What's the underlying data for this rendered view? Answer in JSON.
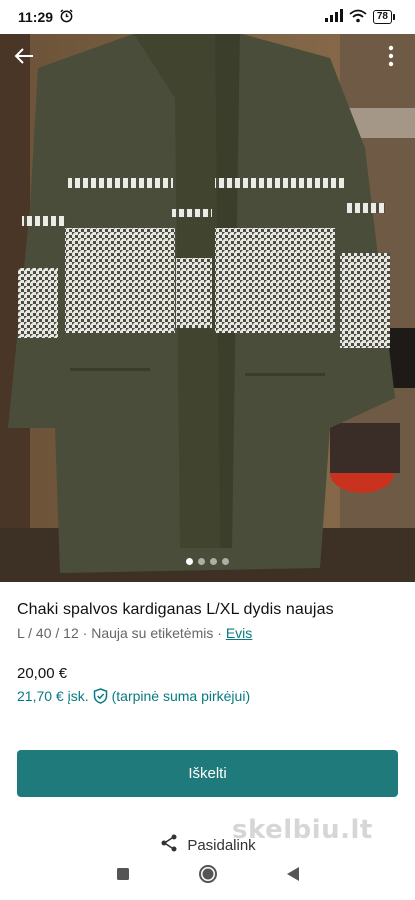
{
  "status_bar": {
    "time": "11:29",
    "battery": "78"
  },
  "listing": {
    "title": "Chaki spalvos kardiganas L/XL dydis naujas",
    "size": "L / 40 / 12",
    "condition": "Nauja su etiketėmis",
    "separator": " · ",
    "brand": "Evis",
    "price": "20,00 €",
    "price_incl": "21,70 € įsk.",
    "price_note": "(tarpinė suma pirkėjui)",
    "photo_count": 4,
    "active_photo": 1
  },
  "actions": {
    "promote_label": "Iškelti",
    "share_label": "Pasidalink"
  },
  "watermark": "skelbiu.lt",
  "icons": {
    "back": "arrow-left-icon",
    "more": "more-vertical-icon",
    "share": "share-icon",
    "shield": "shield-check-icon",
    "alarm": "alarm-icon",
    "signal": "signal-icon",
    "wifi": "wifi-icon",
    "nav_recent": "square-icon",
    "nav_home": "circle-icon",
    "nav_back": "triangle-back-icon"
  },
  "colors": {
    "accent": "#087b82",
    "button": "#1f7a7c",
    "cardigan": "#4a4d3a"
  }
}
